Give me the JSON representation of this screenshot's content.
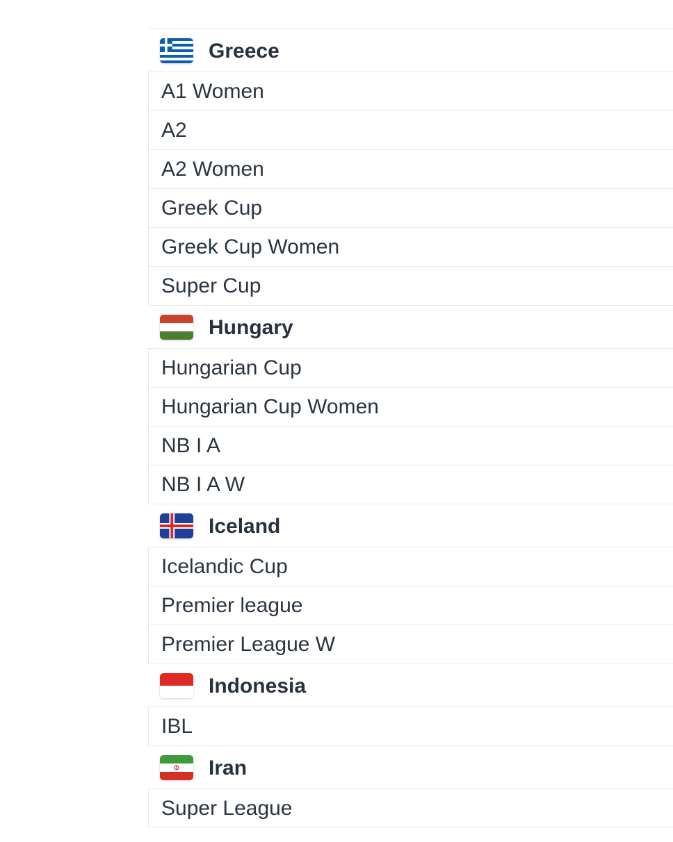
{
  "countries": [
    {
      "name": "Greece",
      "flag_icon": "greece-flag-icon",
      "leagues": [
        "A1 Women",
        "A2",
        "A2 Women",
        "Greek Cup",
        "Greek Cup Women",
        "Super Cup"
      ]
    },
    {
      "name": "Hungary",
      "flag_icon": "hungary-flag-icon",
      "leagues": [
        "Hungarian Cup",
        "Hungarian Cup Women",
        "NB I A",
        "NB I A W"
      ]
    },
    {
      "name": "Iceland",
      "flag_icon": "iceland-flag-icon",
      "leagues": [
        "Icelandic Cup",
        "Premier league",
        "Premier League W"
      ]
    },
    {
      "name": "Indonesia",
      "flag_icon": "indonesia-flag-icon",
      "leagues": [
        "IBL"
      ]
    },
    {
      "name": "Iran",
      "flag_icon": "iran-flag-icon",
      "leagues": [
        "Super League"
      ]
    }
  ],
  "colors": {
    "text": "#2b3442",
    "divider": "#e6e8eb"
  }
}
